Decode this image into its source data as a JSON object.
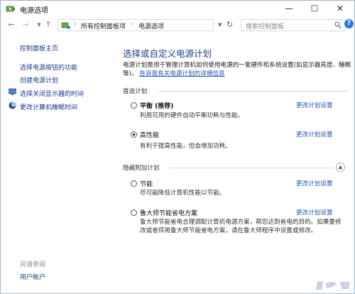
{
  "window": {
    "title": "电源选项"
  },
  "address": {
    "root_crumb": "所有控制面板项",
    "current_crumb": "电源选项",
    "search_placeholder": "搜索控制面板"
  },
  "sidebar": {
    "home": "控制面板主页",
    "links": [
      "选择电源按钮的功能",
      "创建电源计划",
      "选择关闭显示器的时间",
      "更改计算机睡眠时间"
    ],
    "see_also_title": "另请参阅",
    "see_also_links": [
      "用户帐户"
    ]
  },
  "main": {
    "heading": "选择或自定义电源计划",
    "description": "电源计划是用于管理计算机如何使用电源的一套硬件和系统设置(如显示器亮度、睡眠等)。",
    "description_link": "告诉我有关电源计划的详细信息",
    "preferred_label": "首选计划",
    "hidden_label": "隐藏附加计划",
    "change_label": "更改计划设置",
    "plans": [
      {
        "name": "平衡 (推荐)",
        "desc": "利用可用的硬件自动平衡功耗与性能。",
        "selected": false
      },
      {
        "name": "高性能",
        "desc": "有利于提高性能，但会增加功耗。",
        "selected": true
      },
      {
        "name": "节能",
        "desc": "尽可能降低计算机性能以节能。",
        "selected": false
      },
      {
        "name": "鲁大师节能省电方案",
        "desc": "鲁大师节能省电合理调配计算机电源方案，帮您达到省电的目的。如果要修改或者停用鲁大师节能省电方案，请在鲁大师程序中设置或修改。",
        "selected": false
      }
    ]
  }
}
